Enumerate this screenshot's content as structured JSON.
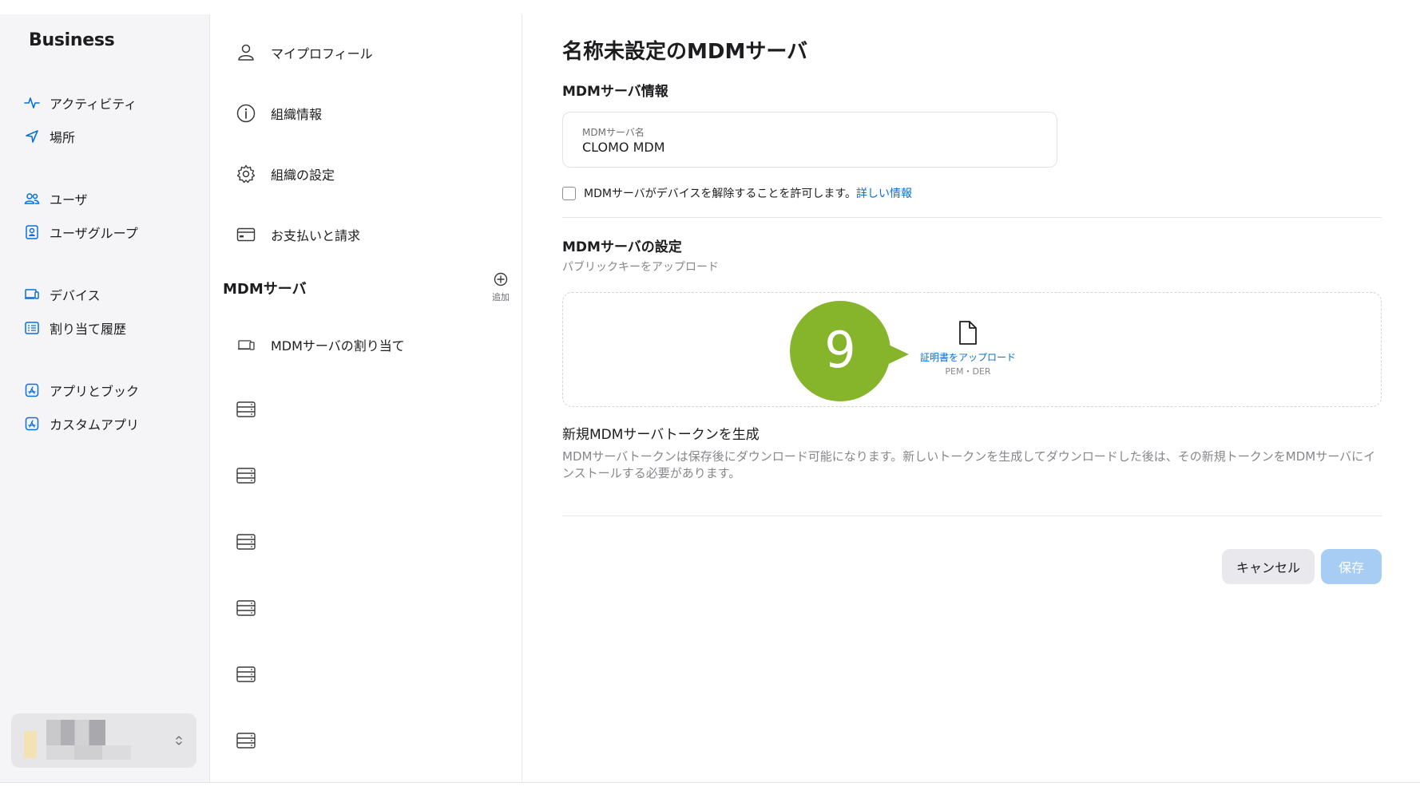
{
  "sidebar": {
    "brand": "Business",
    "items": [
      {
        "label": "アクティビティ",
        "icon": "activity-icon"
      },
      {
        "label": "場所",
        "icon": "location-arrow-icon"
      },
      {
        "label": "ユーザ",
        "icon": "users-icon"
      },
      {
        "label": "ユーザグループ",
        "icon": "user-group-icon"
      },
      {
        "label": "デバイス",
        "icon": "device-icon"
      },
      {
        "label": "割り当て履歴",
        "icon": "list-icon"
      },
      {
        "label": "アプリとブック",
        "icon": "app-store-icon"
      },
      {
        "label": "カスタムアプリ",
        "icon": "custom-app-icon"
      }
    ]
  },
  "settings_nav": {
    "items": [
      {
        "label": "マイプロフィール",
        "icon": "person-icon"
      },
      {
        "label": "組織情報",
        "icon": "info-icon"
      },
      {
        "label": "組織の設定",
        "icon": "gear-icon"
      },
      {
        "label": "お支払いと請求",
        "icon": "credit-card-icon"
      }
    ],
    "mdm_section_title": "MDMサーバ",
    "add_label": "追加",
    "assign_label": "MDMサーバの割り当て"
  },
  "detail": {
    "title": "名称未設定のMDMサーバ",
    "info_heading": "MDMサーバ情報",
    "name_field_label": "MDMサーバ名",
    "name_field_value": "CLOMO MDM",
    "release_checkbox_label": "MDMサーバがデバイスを解除することを許可します。",
    "learn_more": "詳しい情報",
    "settings_heading": "MDMサーバの設定",
    "upload_subtitle": "パブリックキーをアップロード",
    "upload_link": "証明書をアップロード",
    "upload_formats": "PEM・DER",
    "token_heading": "新規MDMサーバトークンを生成",
    "token_description": "MDMサーバトークンは保存後にダウンロード可能になります。新しいトークンを生成してダウンロードした後は、その新規トークンをMDMサーバにインストールする必要があります。",
    "cancel_button": "キャンセル",
    "save_button": "保存"
  },
  "callout": {
    "number": "9",
    "color": "#86b42b"
  },
  "colors": {
    "link": "#0a6fd8",
    "save_disabled": "#a8cdf4",
    "sidebar_bg": "#f5f5f7"
  }
}
